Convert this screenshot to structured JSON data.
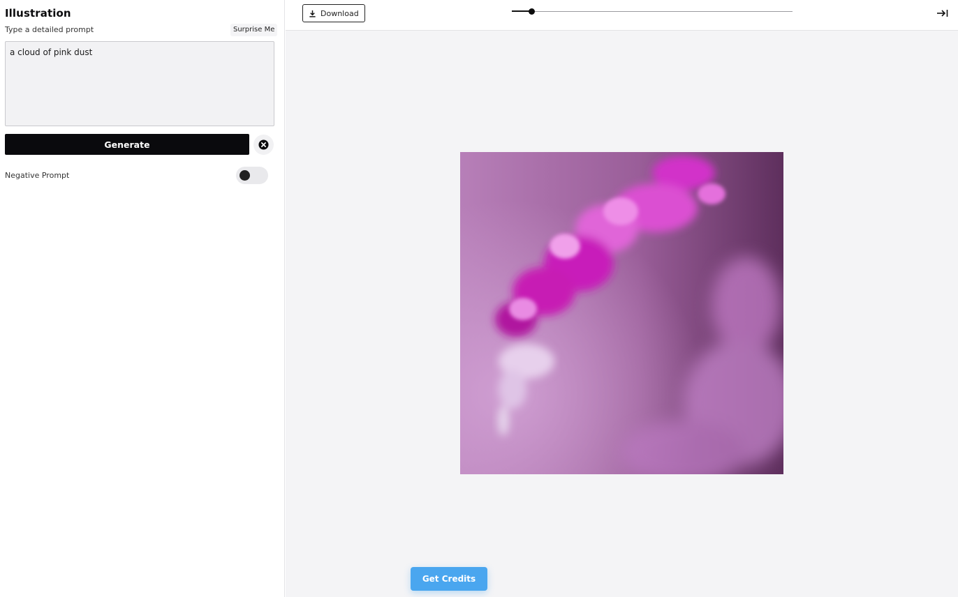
{
  "sidebar": {
    "title": "Illustration",
    "prompt_label": "Type a detailed prompt",
    "surprise_label": "Surprise Me",
    "prompt_value": "a cloud of pink dust",
    "generate_label": "Generate",
    "negative_prompt_label": "Negative Prompt",
    "negative_prompt_enabled": false
  },
  "toolbar": {
    "download_label": "Download",
    "download_icon": "download-icon",
    "zoom_slider_value": 0.07,
    "collapse_icon": "collapse-right-icon"
  },
  "main": {
    "clear_icon": "close-circle-icon",
    "credits_label": "Get Credits"
  },
  "colors": {
    "accent": "#4aa6ef",
    "generate_bg": "#0a0a0d",
    "canvas_bg": "#f4f4f6"
  }
}
